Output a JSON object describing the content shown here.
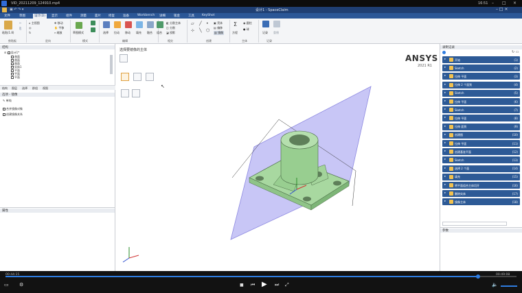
{
  "player": {
    "filename": "VID_20211209_124910.mp4",
    "clock": "16:51",
    "time_current": "00:44:15",
    "time_total": "00:49:08",
    "progress": 0.925,
    "controls": [
      "stop",
      "previous",
      "play",
      "next",
      "fullscreen"
    ]
  },
  "app": {
    "title": "设计1 - SpaceClaim",
    "version_brand": "ANSYS",
    "version_year": "2021 R1",
    "colors": {
      "title": "#1f3f73",
      "ribbon": "#2b5797",
      "history_row": "#2d5a96",
      "model": "#a8d8a0",
      "plane": "#b6b3f3"
    }
  },
  "ribbon": {
    "tabs": [
      "文件",
      "草图",
      "设计(D)",
      "显示",
      "组件",
      "测量",
      "面片",
      "修复",
      "准备",
      "Workbench",
      "详细",
      "钣金",
      "工具",
      "KeyShot"
    ],
    "active_tab": "设计(D)",
    "groups": [
      "剪贴板",
      "定向",
      "模式",
      "编辑",
      "相交",
      "创建",
      "主体",
      "记录"
    ],
    "clipboard": {
      "paste": "粘贴(1.8)"
    },
    "orient": {
      "home": "主视图",
      "pan": "平移",
      "zoom": "缩放",
      "move": "移动"
    },
    "mode": {
      "sketch": "草图模式"
    },
    "edit": {
      "select": "选择",
      "pull": "拉动",
      "move": "移动",
      "fill": "填充",
      "blend": "融合"
    },
    "intersect": {
      "combine": "组合",
      "split_body": "分割主体",
      "split": "分割",
      "project": "投影"
    },
    "create": {
      "shell": "壳体",
      "offset": "偏移",
      "mirror": "镜像"
    },
    "body": {
      "equation": "方程",
      "cylinder": "圆柱",
      "sphere": "球"
    },
    "record": {
      "record": "记录",
      "replay": "重播"
    }
  },
  "structure": {
    "title": "结构",
    "root": "设计1*",
    "items": [
      "曲面",
      "曲面",
      "曲面",
      "实体1",
      "平面",
      "平面",
      "平面"
    ],
    "tabs": [
      "结构",
      "图层",
      "选择",
      "群组",
      "视图"
    ]
  },
  "options": {
    "title": "选项 - 镜像",
    "group": "单纯",
    "check1": "合并镜像对象",
    "check2": "创建镜像关系"
  },
  "properties": {
    "title": "属性"
  },
  "viewport": {
    "prompt": "选择要镜像的主体"
  },
  "history": {
    "title": "录制记录",
    "rows": [
      {
        "label": "开始",
        "num": "(1)"
      },
      {
        "label": "Sketch",
        "num": "(2)"
      },
      {
        "label": "拉伸 平面",
        "num": "(3)"
      },
      {
        "label": "拉伸 2 个面到",
        "num": "(4)"
      },
      {
        "label": "Sketch",
        "num": "(5)"
      },
      {
        "label": "拉伸 平面",
        "num": "(6)"
      },
      {
        "label": "Sketch",
        "num": "(7)"
      },
      {
        "label": "拉伸 平面",
        "num": "(8)"
      },
      {
        "label": "拉伸 面到",
        "num": "(9)"
      },
      {
        "label": "创建图",
        "num": "(10)"
      },
      {
        "label": "拉伸 平面",
        "num": "(11)"
      },
      {
        "label": "创建基准平面",
        "num": "(12)"
      },
      {
        "label": "Sketch",
        "num": "(13)"
      },
      {
        "label": "选择 2 个面",
        "num": "(14)"
      },
      {
        "label": "填充",
        "num": "(15)"
      },
      {
        "label": "将平面组合主体切开",
        "num": "(16)"
      },
      {
        "label": "删除实体",
        "num": "(17)"
      },
      {
        "label": "镜像主体",
        "num": "(18)"
      }
    ]
  },
  "parameters": {
    "title": "参数"
  }
}
